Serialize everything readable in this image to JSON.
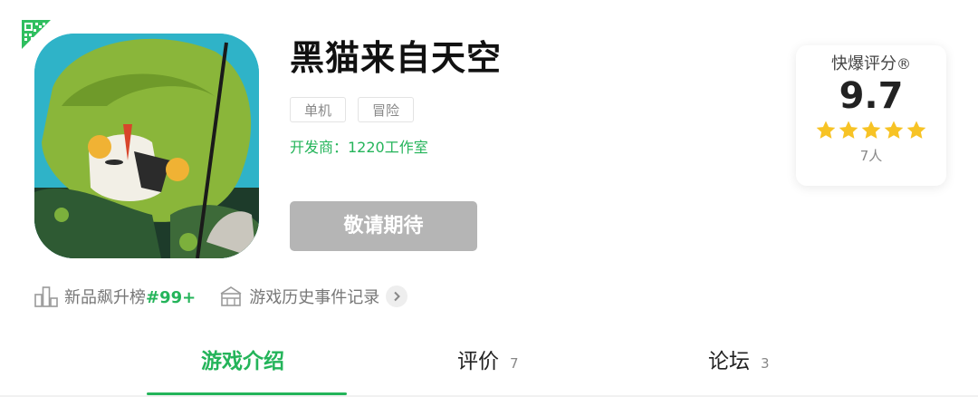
{
  "game": {
    "title": "黑猫来自天空",
    "tags": [
      "单机",
      "冒险"
    ],
    "developer": "开发商：1220工作室",
    "action_button": "敬请期待"
  },
  "rating": {
    "label": "快爆评分",
    "registered_mark": "®",
    "score": "9.7",
    "stars": 5,
    "raters": "7人",
    "star_color": "#f7c325"
  },
  "rank": {
    "label": "新品飙升榜",
    "position": "#99+",
    "history_link": "游戏历史事件记录"
  },
  "tabs": [
    {
      "label": "游戏介绍",
      "count": "",
      "active": true
    },
    {
      "label": "评价",
      "count": "7",
      "active": false
    },
    {
      "label": "论坛",
      "count": "3",
      "active": false
    }
  ],
  "colors": {
    "accent": "#24b45a",
    "button_disabled": "#b5b5b5",
    "icon_bg": "#2fb3c8"
  },
  "icons": [
    "qr-code-icon",
    "bar-chart-icon",
    "history-building-icon",
    "chevron-right-icon",
    "star-icon"
  ]
}
